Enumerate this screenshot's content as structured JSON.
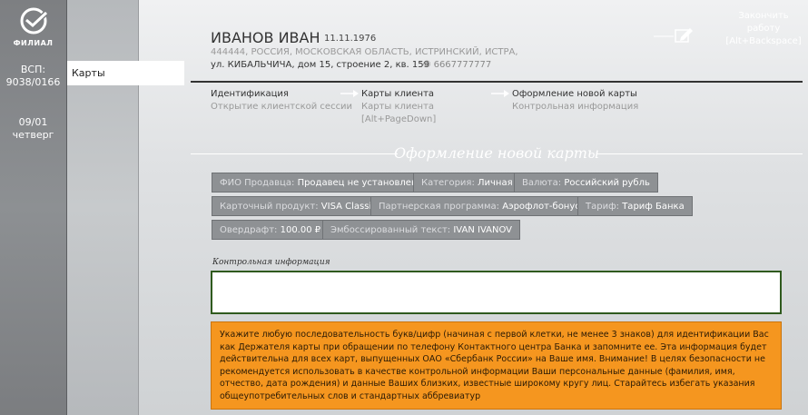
{
  "sidebar": {
    "logo_text": "ФИЛИАЛ",
    "vsp_label": "ВСП:",
    "vsp_value": "9038/0166",
    "date": "09/01",
    "weekday": "четверг"
  },
  "nav": {
    "active_item": "Карты"
  },
  "client": {
    "name": "ИВАНОВ ИВАН",
    "dob": "11.11.1976",
    "address_line1": "444444, РОССИЯ, МОСКОВСКАЯ ОБЛАСТЬ, ИСТРИНСКИЙ, ИСТРА,",
    "address_line2": "ул. КИБАЛЬЧИЧА, дом 15, строение 2, кв. 159",
    "phone": "6667777777"
  },
  "finish": {
    "line1": "Закончить",
    "line2": "работу",
    "line3": "[Alt+Backspace]"
  },
  "steps": [
    {
      "title": "Идентификация",
      "sub1": "Открытие клиентской сессии",
      "sub2": ""
    },
    {
      "title": "Карты клиента",
      "sub1": "Карты клиента",
      "sub2": "[Alt+PageDown]"
    },
    {
      "title": "Оформление новой карты",
      "sub1": "Контрольная информация",
      "sub2": ""
    }
  ],
  "section_title": "Оформление новой карты",
  "tags": [
    {
      "label": "ФИО Продавца:",
      "value": "Продавец не установлен"
    },
    {
      "label": "Категория:",
      "value": "Личная"
    },
    {
      "label": "Валюта:",
      "value": "Российский рубль"
    },
    {
      "label": "Карточный продукт:",
      "value": "VISA Classic"
    },
    {
      "label": "Партнерская программа:",
      "value": "Аэрофлот-бонус"
    },
    {
      "label": "Тариф:",
      "value": "Тариф Банка"
    },
    {
      "label": "Овердрафт:",
      "value": "100.00 ₽"
    },
    {
      "label": "Эмбоссированный текст:",
      "value": "IVAN IVANOV"
    }
  ],
  "control": {
    "label": "Контрольная информация",
    "value": ""
  },
  "warning_text": "Укажите любую последовательность букв/цифр (начиная с первой клетки, не менее 3 знаков) для идентификации Вас как Держателя карты при обращении по телефону Контактного центра Банка и запомните ее. Эта информация будет действительна для всех карт, выпущенных ОАО «Сбербанк России» на Ваше имя. Внимание! В целях безопасности не рекомендуется использовать в качестве контрольной информации Ваши персональные данные (фамилия, имя, отчество, дата рождения) и данные Ваших близких, известные широкому кругу лиц. Старайтесь избегать указания общеупотребительных слов и стандартных аббревиатур"
}
